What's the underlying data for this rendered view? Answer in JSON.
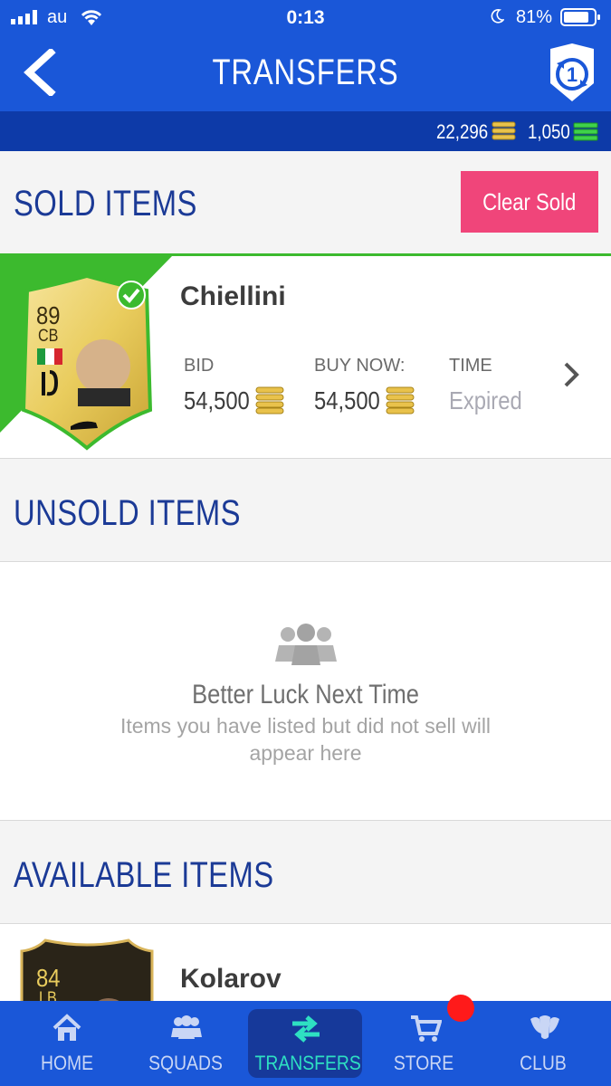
{
  "status_bar": {
    "carrier": "au",
    "time": "0:13",
    "battery": "81%"
  },
  "header": {
    "title": "TRANSFERS"
  },
  "currency": {
    "coins": "22,296",
    "points": "1,050"
  },
  "sold": {
    "title": "SOLD ITEMS",
    "clear_label": "Clear Sold",
    "item": {
      "name": "Chiellini",
      "rating": "89",
      "position": "CB",
      "bid_label": "BID",
      "bid_value": "54,500",
      "buy_now_label": "BUY NOW:",
      "buy_now_value": "54,500",
      "time_label": "TIME",
      "time_value": "Expired"
    }
  },
  "unsold": {
    "title": "UNSOLD ITEMS",
    "empty_title": "Better Luck Next Time",
    "empty_text_1": "Items you have listed but did not sell will",
    "empty_text_2": "appear here"
  },
  "available": {
    "title": "AVAILABLE ITEMS",
    "item": {
      "name": "Kolarov",
      "rating": "84",
      "position": "LB"
    }
  },
  "nav": {
    "home": "HOME",
    "squads": "SQUADS",
    "transfers": "TRANSFERS",
    "store": "STORE",
    "club": "CLUB"
  },
  "colors": {
    "brand_blue": "#1a57d8",
    "dark_blue": "#0d3aa8",
    "heading_blue": "#1b3a96",
    "clear_pink": "#f0457a",
    "sold_green": "#3cba2e",
    "active_tab": "#2ee0c2",
    "notification_red": "#ff1a1a"
  }
}
